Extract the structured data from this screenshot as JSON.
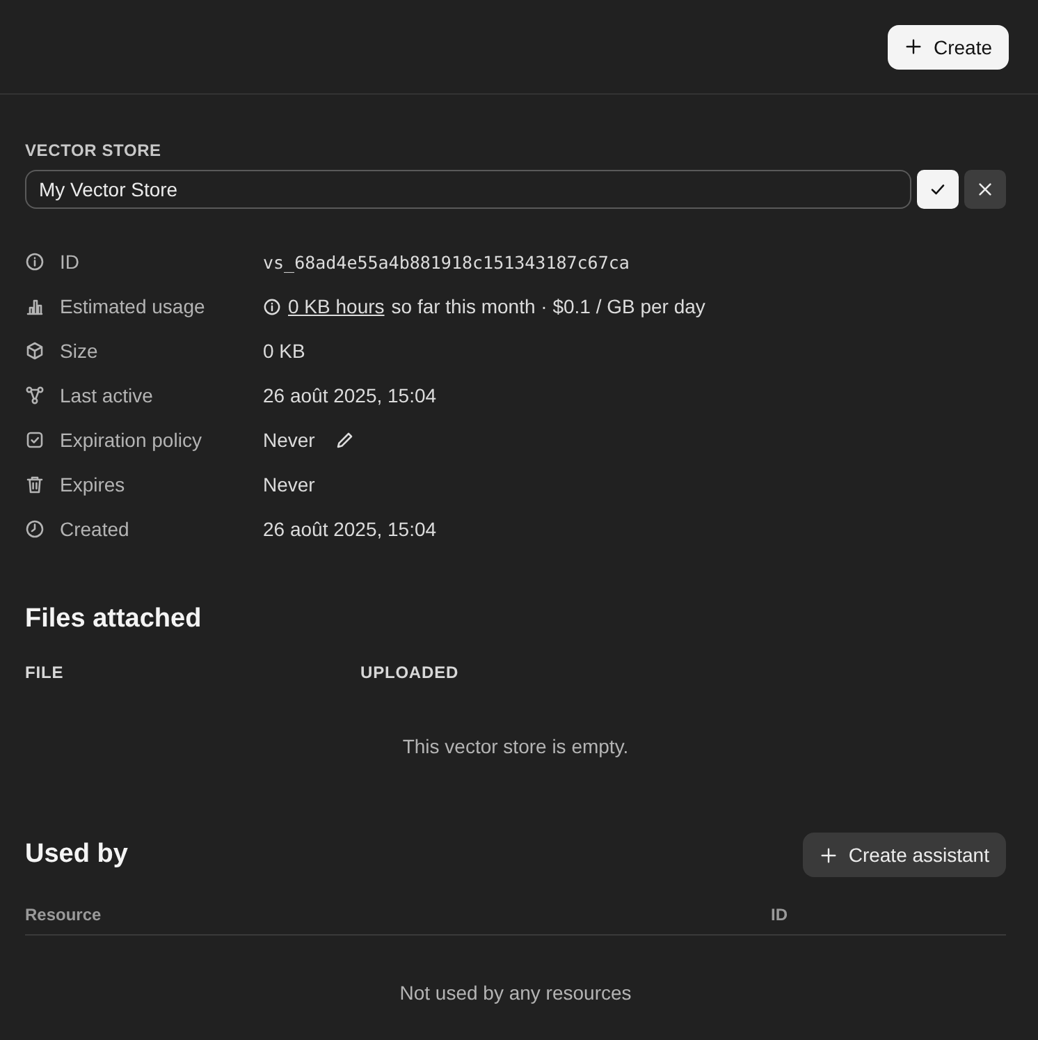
{
  "header": {
    "create_button": "Create"
  },
  "store": {
    "label": "VECTOR STORE",
    "name": "My Vector Store"
  },
  "properties": [
    {
      "label": "ID",
      "value": "vs_68ad4e55a4b881918c151343187c67ca",
      "kind": "mono"
    },
    {
      "label": "Estimated usage",
      "kind": "usage",
      "link": "0 KB hours",
      "value": "so far this month · $0.1 / GB per day"
    },
    {
      "label": "Size",
      "value": "0 KB",
      "kind": "text"
    },
    {
      "label": "Last active",
      "value": "26 août 2025, 15:04",
      "kind": "text"
    },
    {
      "label": "Expiration policy",
      "value": "Never",
      "kind": "editable"
    },
    {
      "label": "Expires",
      "value": "Never",
      "kind": "text"
    },
    {
      "label": "Created",
      "value": "26 août 2025, 15:04",
      "kind": "text"
    }
  ],
  "files": {
    "title": "Files attached",
    "columns": [
      "FILE",
      "UPLOADED"
    ],
    "empty": "This vector store is empty."
  },
  "used_by": {
    "title": "Used by",
    "button": "Create assistant",
    "columns": [
      "Resource",
      "ID"
    ],
    "empty": "Not used by any resources"
  }
}
